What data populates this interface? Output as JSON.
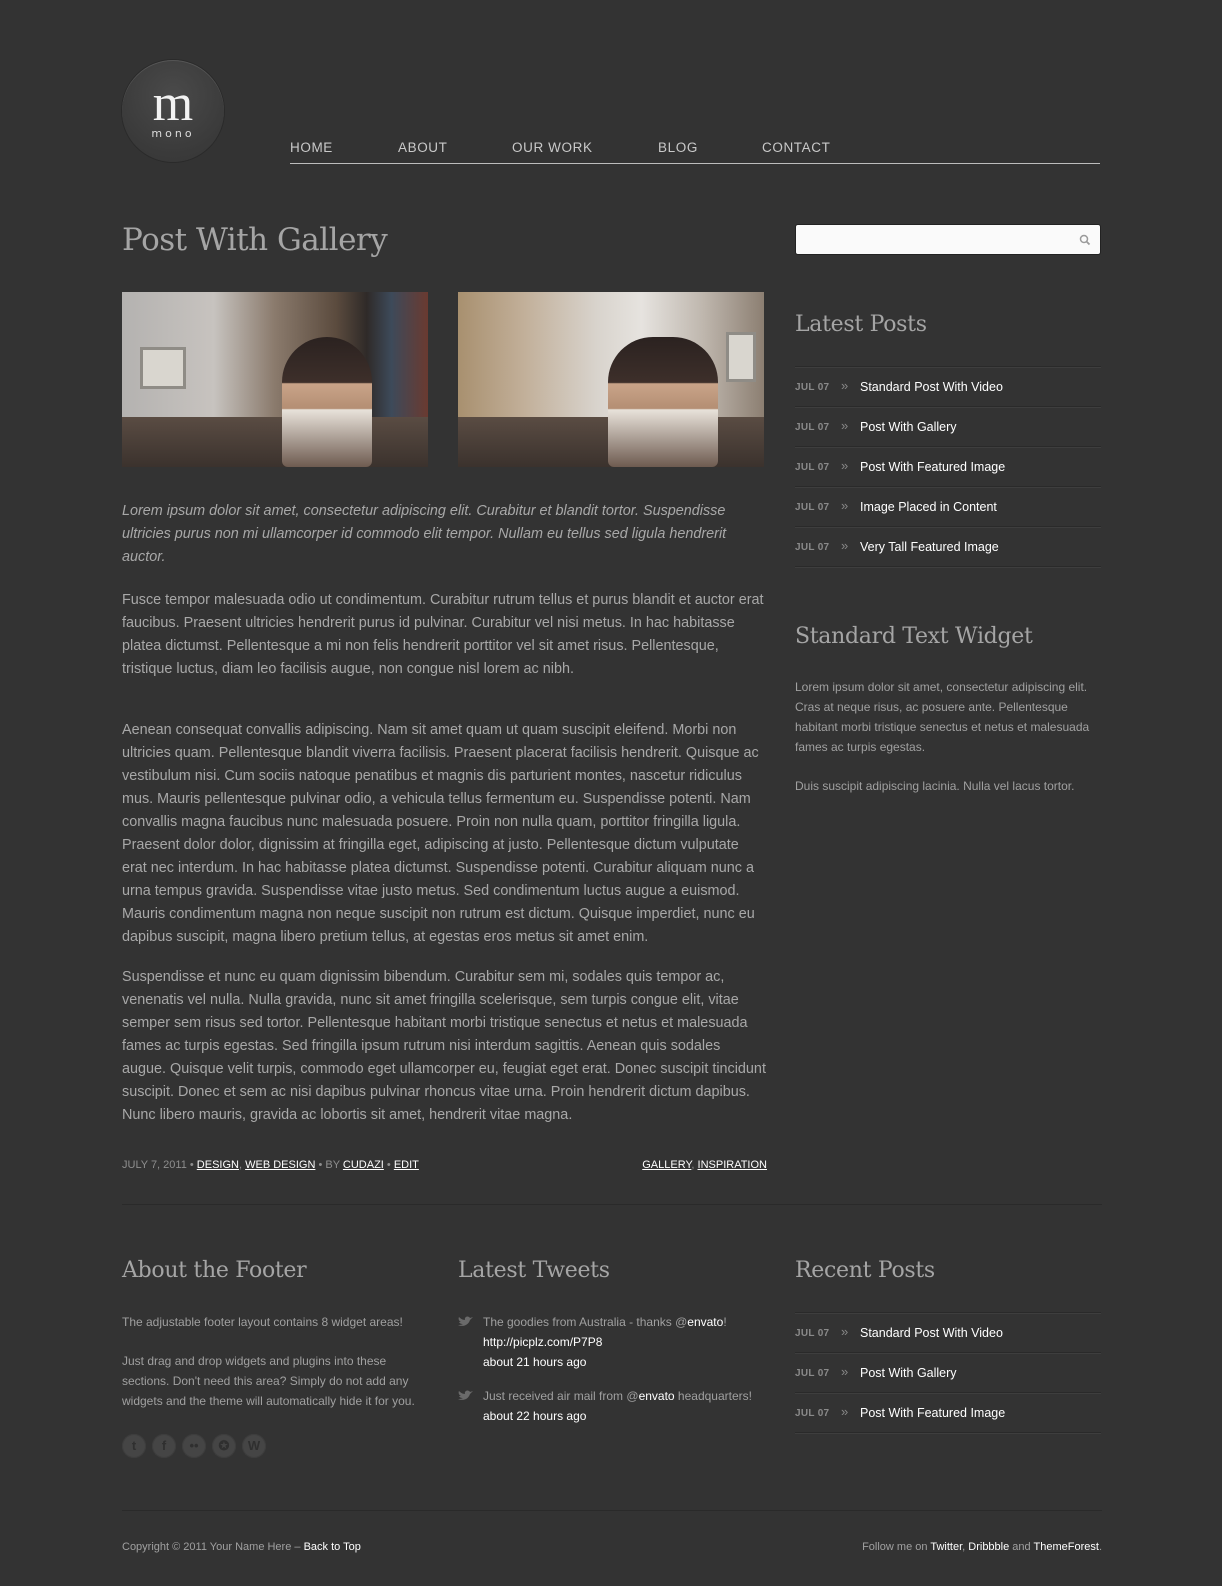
{
  "logo": {
    "letter": "m",
    "word": "mono"
  },
  "nav": {
    "home": "HOME",
    "about": "ABOUT",
    "our_work": "OUR WORK",
    "blog": "BLOG",
    "contact": "CONTACT"
  },
  "post": {
    "title": "Post With Gallery",
    "intro": "Lorem ipsum dolor sit amet, consectetur adipiscing elit. Curabitur et blandit tortor. Suspendisse ultricies purus non mi ullamcorper id commodo elit tempor. Nullam eu tellus sed ligula hendrerit auctor.",
    "paragraphs": [
      "Fusce tempor malesuada odio ut condimentum. Curabitur rutrum tellus et purus blandit et auctor erat faucibus. Praesent ultricies hendrerit purus id pulvinar. Curabitur vel nisi metus. In hac habitasse platea dictumst. Pellentesque a mi non felis hendrerit porttitor vel sit amet risus. Pellentesque, tristique luctus, diam leo facilisis augue, non congue nisl lorem ac nibh.",
      "Aenean consequat convallis adipiscing. Nam sit amet quam ut quam suscipit eleifend. Morbi non ultricies quam. Pellentesque blandit viverra facilisis. Praesent placerat facilisis hendrerit. Quisque ac vestibulum nisi. Cum sociis natoque penatibus et magnis dis parturient montes, nascetur ridiculus mus. Mauris pellentesque pulvinar odio, a vehicula tellus fermentum eu. Suspendisse potenti. Nam convallis magna faucibus nunc malesuada posuere. Proin non nulla quam, porttitor fringilla ligula. Praesent dolor dolor, dignissim at fringilla eget, adipiscing at justo. Pellentesque dictum vulputate erat nec interdum. In hac habitasse platea dictumst. Suspendisse potenti. Curabitur aliquam nunc a urna tempus gravida. Suspendisse vitae justo metus. Sed condimentum luctus augue a euismod. Mauris condimentum magna non neque suscipit non rutrum est dictum. Quisque imperdiet, nunc eu dapibus suscipit, magna libero pretium tellus, at egestas eros metus sit amet enim.",
      "Suspendisse et nunc eu quam dignissim bibendum. Curabitur sem mi, sodales quis tempor ac, venenatis vel nulla. Nulla gravida, nunc sit amet fringilla scelerisque, sem turpis congue elit, vitae semper sem risus sed tortor. Pellentesque habitant morbi tristique senectus et netus et malesuada fames ac turpis egestas. Sed fringilla ipsum rutrum nisi interdum sagittis. Aenean quis sodales augue. Quisque velit turpis, commodo eget ullamcorper eu, feugiat eget erat. Donec suscipit tincidunt suscipit. Donec et sem ac nisi dapibus pulvinar rhoncus vitae urna. Proin hendrerit dictum dapibus. Nunc libero mauris, gravida ac lobortis sit amet, hendrerit vitae magna."
    ],
    "meta": {
      "date": "JULY 7, 2011",
      "sep": " • ",
      "cat1": "DESIGN",
      "comma": ", ",
      "cat2": "WEB DESIGN",
      "by": " • BY ",
      "author": "CUDAZI",
      "edit": "EDIT",
      "tag1": "GALLERY",
      "tag2": "INSPIRATION"
    }
  },
  "sidebar": {
    "search_placeholder": "",
    "latest_posts_title": "Latest Posts",
    "latest_posts": [
      {
        "date": "JUL 07",
        "title": "Standard Post With Video"
      },
      {
        "date": "JUL 07",
        "title": "Post With Gallery"
      },
      {
        "date": "JUL 07",
        "title": "Post With Featured Image"
      },
      {
        "date": "JUL 07",
        "title": "Image Placed in Content"
      },
      {
        "date": "JUL 07",
        "title": "Very Tall Featured Image"
      }
    ],
    "text_widget_title": "Standard Text Widget",
    "text_widget_p1": "Lorem ipsum dolor sit amet, consectetur adipiscing elit. Cras at neque risus, ac posuere ante. Pellentesque habitant morbi tristique senectus et netus et malesuada fames ac turpis egestas.",
    "text_widget_p2": "Duis suscipit adipiscing lacinia. Nulla vel lacus tortor."
  },
  "footer": {
    "about_title": "About the Footer",
    "about_p1": "The adjustable footer layout contains 8 widget areas!",
    "about_p2": "Just drag and drop widgets and plugins into these sections. Don't need this area? Simply do not add any widgets and the theme will automatically hide it for you.",
    "social": [
      "twitter-icon",
      "facebook-icon",
      "flickr-icon",
      "dribbble-icon",
      "wordpress-icon"
    ],
    "tweets_title": "Latest Tweets",
    "tweet1_text": "The goodies from Australia - thanks @",
    "tweet1_handle": "envato",
    "tweet1_end": "!",
    "tweet1_link": "http://picplz.com/P7P8",
    "tweet1_time": "about 21 hours ago",
    "tweet2_text": "Just received air mail from @",
    "tweet2_handle": "envato",
    "tweet2_end": " headquarters!",
    "tweet2_time": "about 22 hours ago",
    "recent_title": "Recent Posts",
    "recent_posts": [
      {
        "date": "JUL 07",
        "title": "Standard Post With Video"
      },
      {
        "date": "JUL 07",
        "title": "Post With Gallery"
      },
      {
        "date": "JUL 07",
        "title": "Post With Featured Image"
      }
    ],
    "copyright": "Copyright © 2011 Your Name Here – ",
    "back_to_top": "Back to Top",
    "follow_prefix": "Follow me on ",
    "follow_twitter": "Twitter",
    "follow_comma": ", ",
    "follow_dribbble": "Dribbble",
    "follow_and": " and ",
    "follow_themeforest": "ThemeForest",
    "follow_end": "."
  }
}
